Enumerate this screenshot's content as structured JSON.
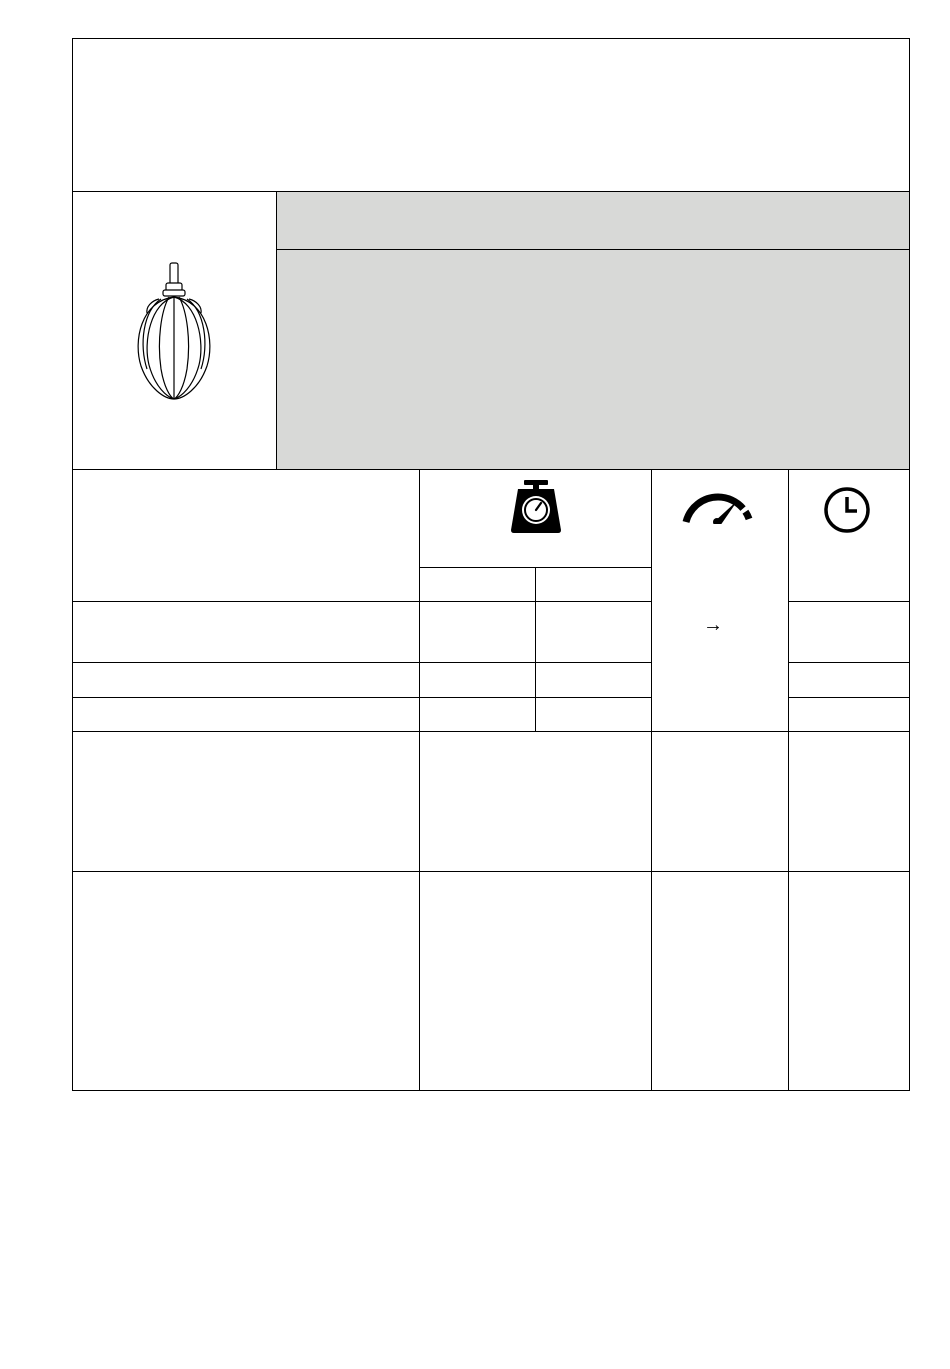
{
  "header": {
    "title": ""
  },
  "attachment": {
    "name": "",
    "description": "",
    "image_icon": "whisk-icon"
  },
  "table": {
    "column_icons": {
      "quantity": "kitchen-scale-icon",
      "speed": "speedometer-icon",
      "time": "clock-icon"
    },
    "speed_arrow": "→",
    "rows": [
      {
        "label": "",
        "qty_a": "",
        "qty_b": "",
        "time": ""
      },
      {
        "label": "",
        "qty_a": "",
        "qty_b": "",
        "time": ""
      },
      {
        "label": "",
        "qty_a": "",
        "qty_b": "",
        "time": ""
      },
      {
        "label": "",
        "qty": "",
        "speed": "",
        "time": ""
      },
      {
        "label": "",
        "qty": "",
        "speed": "",
        "time": ""
      }
    ]
  },
  "colors": {
    "grey_panel": "#d8d9d7",
    "line": "#000000"
  }
}
